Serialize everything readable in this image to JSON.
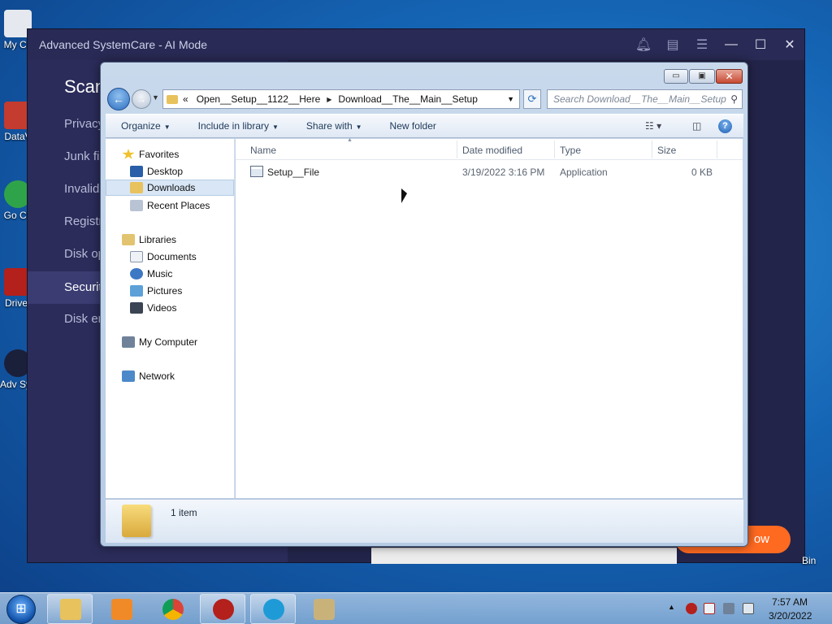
{
  "desktop": {
    "icons": [
      {
        "label": "My Co",
        "color": "#e5e9ef"
      },
      {
        "label": "DataV",
        "color": "#c43b2f"
      },
      {
        "label": "Go Ch",
        "color": "#2fa34a"
      },
      {
        "label": "Driver",
        "color": "#b4201b"
      },
      {
        "label": "Adv Syste",
        "color": "#1a1f3a"
      }
    ]
  },
  "asc": {
    "title": "Advanced SystemCare - AI Mode",
    "scan_title": "Scan",
    "sidebar": [
      "Privacy",
      "Junk file",
      "Invalid",
      "Registry",
      "Disk op",
      "Security",
      "Disk err"
    ],
    "action_button": "ow",
    "bin_label": "Bin"
  },
  "dialog": {
    "controls": {
      "minimize": "▭",
      "maximize": "▣",
      "close": "✕"
    },
    "breadcrumb": {
      "prefix": "«",
      "parts": [
        "Open__Setup__1122__Here",
        "Download__The__Main__Setup"
      ]
    },
    "search_placeholder": "Search Download__The__Main__Setup",
    "toolbar": {
      "organize": "Organize",
      "include_in_library": "Include in library",
      "share_with": "Share with",
      "new_folder": "New folder"
    },
    "nav": {
      "favorites": "Favorites",
      "desktop": "Desktop",
      "downloads": "Downloads",
      "recent_places": "Recent Places",
      "libraries": "Libraries",
      "documents": "Documents",
      "music": "Music",
      "pictures": "Pictures",
      "videos": "Videos",
      "my_computer": "My Computer",
      "network": "Network"
    },
    "columns": {
      "name": "Name",
      "date_modified": "Date modified",
      "type": "Type",
      "size": "Size"
    },
    "files": [
      {
        "name": "Setup__File",
        "date_modified": "3/19/2022 3:16 PM",
        "type": "Application",
        "size": "0 KB"
      }
    ],
    "item_count": "1 item"
  },
  "taskbar": {
    "clock_time": "7:57 AM",
    "clock_date": "3/20/2022",
    "tasks": [
      {
        "name": "explorer",
        "color": "#e8c25c"
      },
      {
        "name": "media-player",
        "color": "#f08a28"
      },
      {
        "name": "chrome",
        "color": "#2fa34a"
      },
      {
        "name": "security-app",
        "color": "#b4201b"
      },
      {
        "name": "advanced-systemcare",
        "color": "#1e9bd7"
      },
      {
        "name": "lock-app",
        "color": "#c9b27a"
      }
    ]
  }
}
